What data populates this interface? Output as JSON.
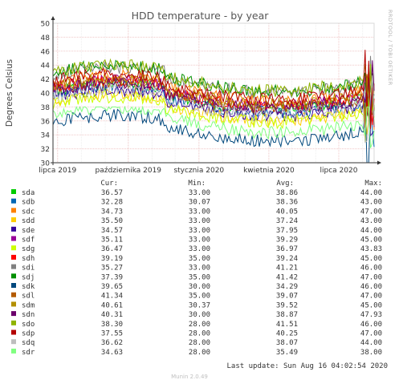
{
  "chart_data": {
    "type": "line",
    "title": "HDD temperature - by year",
    "ylabel": "Degrees Celsius",
    "side_label": "RRDTOOL / TOBI OETIKER",
    "ylim": [
      30,
      50
    ],
    "yticks": [
      30,
      32,
      34,
      36,
      38,
      40,
      42,
      44,
      46,
      48,
      50
    ],
    "x_range": [
      "2019-06-25",
      "2020-08-16"
    ],
    "xticks": [
      {
        "label": "lipca 2019",
        "date": "2019-07-01"
      },
      {
        "label": "października 2019",
        "date": "2019-10-01"
      },
      {
        "label": "stycznia 2020",
        "date": "2020-01-01"
      },
      {
        "label": "kwietnia 2020",
        "date": "2020-04-01"
      },
      {
        "label": "lipca 2020",
        "date": "2020-07-01"
      }
    ],
    "legend_headers": {
      "cur": "Cur:",
      "min": "Min:",
      "avg": "Avg:",
      "max": "Max:"
    },
    "series": [
      {
        "name": "sda",
        "color": "#00cc00",
        "cur": "36.57",
        "min": "33.00",
        "avg": "38.86",
        "max": "44.00"
      },
      {
        "name": "sdb",
        "color": "#0066b3",
        "cur": "32.28",
        "min": "30.07",
        "avg": "38.36",
        "max": "43.00"
      },
      {
        "name": "sdc",
        "color": "#ff8000",
        "cur": "34.73",
        "min": "33.00",
        "avg": "40.05",
        "max": "47.00"
      },
      {
        "name": "sdd",
        "color": "#ffcc00",
        "cur": "35.50",
        "min": "33.00",
        "avg": "37.24",
        "max": "43.00"
      },
      {
        "name": "sde",
        "color": "#330099",
        "cur": "34.57",
        "min": "33.00",
        "avg": "37.95",
        "max": "44.00"
      },
      {
        "name": "sdf",
        "color": "#990099",
        "cur": "35.11",
        "min": "33.00",
        "avg": "39.29",
        "max": "45.00"
      },
      {
        "name": "sdg",
        "color": "#ccff00",
        "cur": "36.47",
        "min": "33.00",
        "avg": "36.97",
        "max": "43.83"
      },
      {
        "name": "sdh",
        "color": "#ff0000",
        "cur": "39.19",
        "min": "35.00",
        "avg": "39.24",
        "max": "45.00"
      },
      {
        "name": "sdi",
        "color": "#808080",
        "cur": "35.27",
        "min": "33.00",
        "avg": "41.21",
        "max": "46.00"
      },
      {
        "name": "sdj",
        "color": "#008f00",
        "cur": "37.39",
        "min": "35.00",
        "avg": "41.42",
        "max": "47.00"
      },
      {
        "name": "sdk",
        "color": "#00487d",
        "cur": "39.65",
        "min": "30.00",
        "avg": "34.29",
        "max": "46.00"
      },
      {
        "name": "sdl",
        "color": "#b35a00",
        "cur": "41.34",
        "min": "35.00",
        "avg": "39.07",
        "max": "47.00"
      },
      {
        "name": "sdm",
        "color": "#b38f00",
        "cur": "40.61",
        "min": "30.37",
        "avg": "39.52",
        "max": "45.00"
      },
      {
        "name": "sdn",
        "color": "#6b006b",
        "cur": "40.31",
        "min": "30.00",
        "avg": "38.87",
        "max": "47.93"
      },
      {
        "name": "sdo",
        "color": "#8fb300",
        "cur": "38.30",
        "min": "28.00",
        "avg": "41.51",
        "max": "46.00"
      },
      {
        "name": "sdp",
        "color": "#b30000",
        "cur": "37.55",
        "min": "28.00",
        "avg": "40.25",
        "max": "47.00"
      },
      {
        "name": "sdq",
        "color": "#bebebe",
        "cur": "36.62",
        "min": "28.00",
        "avg": "38.07",
        "max": "44.00"
      },
      {
        "name": "sdr",
        "color": "#80ff80",
        "cur": "34.63",
        "min": "28.00",
        "avg": "35.49",
        "max": "38.00"
      }
    ],
    "last_update": "Last update: Sun Aug 16 04:02:54 2020",
    "footer": "Munin 2.0.49",
    "grid": true,
    "legend_placement": "bottom"
  }
}
